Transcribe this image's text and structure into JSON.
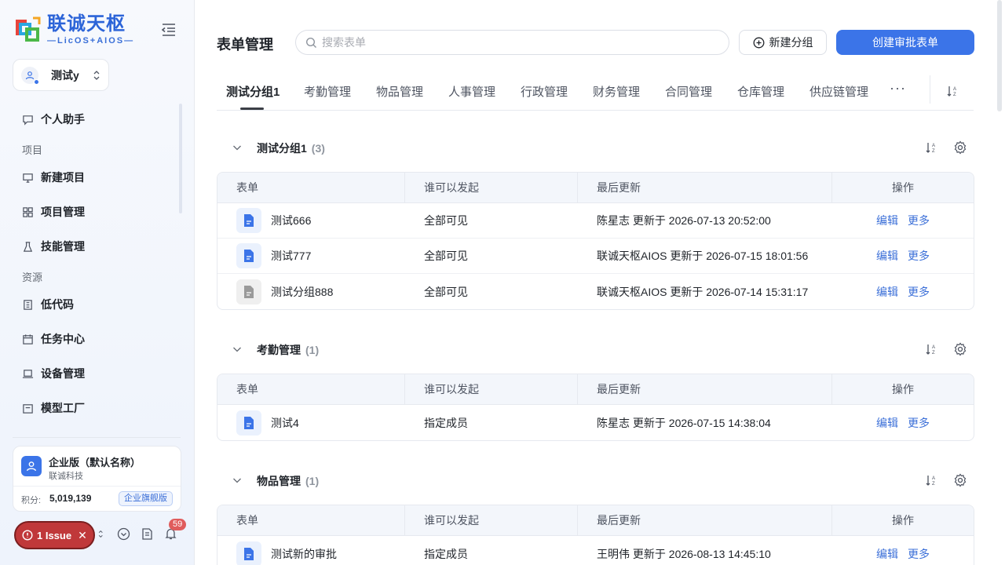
{
  "brand": {
    "name_cn": "联诚天枢",
    "name_en": "—LicOS+AIOS—"
  },
  "workspace": {
    "name": "测试y"
  },
  "nav": {
    "assistant": "个人助手",
    "section_project": "项目",
    "new_project": "新建项目",
    "project_mgmt": "项目管理",
    "skill_mgmt": "技能管理",
    "section_resource": "资源",
    "lowcode": "低代码",
    "task_center": "任务中心",
    "device_mgmt": "设备管理",
    "model_factory": "模型工厂"
  },
  "org": {
    "name": "企业版（默认名称）",
    "sub": "联诚科技",
    "points_label": "积分:",
    "points": "5,019,139",
    "badge": "企业旗舰版"
  },
  "issue": {
    "label": "1 Issue",
    "close": "✕"
  },
  "notifications": {
    "count": "59"
  },
  "page": {
    "title": "表单管理"
  },
  "search": {
    "placeholder": "搜索表单"
  },
  "buttons": {
    "new_group": "新建分组",
    "create_form": "创建审批表单"
  },
  "tabs": [
    "测试分组1",
    "考勤管理",
    "物品管理",
    "人事管理",
    "行政管理",
    "财务管理",
    "合同管理",
    "仓库管理",
    "供应链管理"
  ],
  "tab_more": "···",
  "columns": {
    "form": "表单",
    "who": "谁可以发起",
    "updated": "最后更新",
    "ops": "操作"
  },
  "actions": {
    "edit": "编辑",
    "more": "更多"
  },
  "groups": [
    {
      "name": "测试分组1",
      "count": "(3)",
      "rows": [
        {
          "name": "测试666",
          "who": "全部可见",
          "updated": "陈星志 更新于 2026-07-13 20:52:00",
          "icon": "doc-blue"
        },
        {
          "name": "测试777",
          "who": "全部可见",
          "updated": "联诚天枢AIOS 更新于 2026-07-15 18:01:56",
          "icon": "doc-blue"
        },
        {
          "name": "测试分组888",
          "who": "全部可见",
          "updated": "联诚天枢AIOS 更新于 2026-07-14 15:31:17",
          "icon": "doc-gray"
        }
      ]
    },
    {
      "name": "考勤管理",
      "count": "(1)",
      "rows": [
        {
          "name": "测试4",
          "who": "指定成员",
          "updated": "陈星志 更新于 2026-07-15 14:38:04",
          "icon": "doc-blue"
        }
      ]
    },
    {
      "name": "物品管理",
      "count": "(1)",
      "rows": [
        {
          "name": "测试新的审批",
          "who": "指定成员",
          "updated": "王明伟 更新于 2026-08-13 14:45:10",
          "icon": "doc-blue"
        }
      ]
    }
  ],
  "colors": {
    "primary": "#3b74e8",
    "issue": "#c0383a",
    "badge": "#e05c5c"
  }
}
